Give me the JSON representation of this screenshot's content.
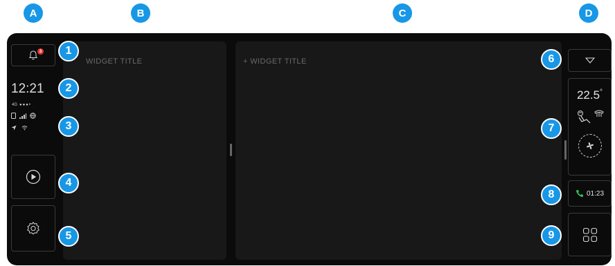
{
  "columns": [
    "A",
    "B",
    "C",
    "D"
  ],
  "badges": [
    "1",
    "2",
    "3",
    "4",
    "5",
    "6",
    "7",
    "8",
    "9"
  ],
  "left_rail": {
    "notification_count": "3",
    "clock": "12:21",
    "network": "4G",
    "signal_dots": "●●●•"
  },
  "widgets": {
    "left_title": "WIDGET TITLE",
    "main_title": "+ WIDGET TITLE"
  },
  "climate": {
    "temperature": "22.5",
    "unit": "°"
  },
  "call": {
    "duration": "01:23"
  },
  "colors": {
    "badge": "#1897e6",
    "notification": "#e53935",
    "call_icon": "#2fbf55"
  }
}
